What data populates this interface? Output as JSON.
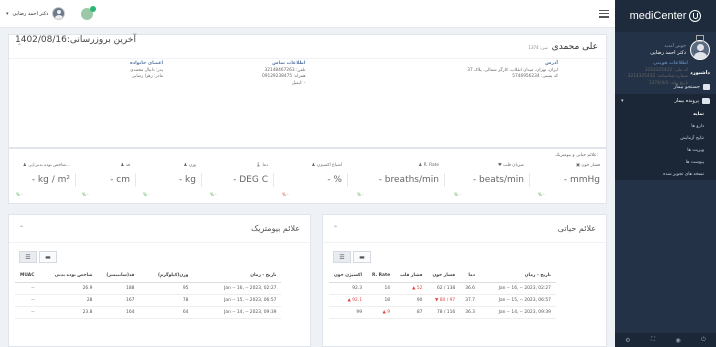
{
  "brand": {
    "name": "mediCenter"
  },
  "sidebar": {
    "greeting": "خوش آمدید",
    "user_name": "دکتر احمد رضایی",
    "items": [
      {
        "label": "داشبورد"
      },
      {
        "label": "جستجو بیمار"
      },
      {
        "label": "پرونده بیمار"
      }
    ],
    "subitems": [
      {
        "label": "نمایه"
      },
      {
        "label": "دارو ها"
      },
      {
        "label": "نتایج آزمایش"
      },
      {
        "label": "ویزیت ها"
      },
      {
        "label": "پیوست ها"
      },
      {
        "label": "نسخه های تجویز شده"
      }
    ]
  },
  "topbar": {
    "user_name": "دکتر احمد رضایی"
  },
  "patient": {
    "name": "علی محمدی",
    "age": "سن: 1374",
    "last_update": "آخرین بروزرسانی:1402/08/16",
    "dots": "...",
    "identity": {
      "title": "اطلاعات هویتی",
      "lines": [
        "کد ملی: 3214325432",
        "شماره شناسنامه: 3214325432",
        "تاریخ تولد: 1374/4/3"
      ]
    },
    "address": {
      "title": "آدرس",
      "lines": [
        "ایران، تهران، میدان انقلاب، کارگر شمالی، پلاک 37",
        "کد پستی: 5746956234"
      ]
    },
    "contact": {
      "title": "اطلاعات تماس",
      "lines": [
        "تلفن: 32148467263",
        "همراه: 09129238475",
        "ایمیل: -"
      ]
    },
    "family": {
      "title": "اعضای خانواده",
      "lines": [
        "پدر: دانیال محمدی",
        "مادر: زهرا رضایی"
      ]
    }
  },
  "vitals": {
    "title": "علائم حیاتی و بیومتریک:",
    "items": [
      {
        "label": "فشار خون",
        "value": "- mmHg",
        "trend": "% -"
      },
      {
        "label": "ضربان قلب",
        "value": "- beats/min",
        "trend": "% -"
      },
      {
        "label": "R. Rate",
        "value": "- breaths/min",
        "trend": "% -"
      },
      {
        "label": "اشباع اکسیژن",
        "value": "- %",
        "trend": "% -"
      },
      {
        "label": "دما",
        "value": "- DEG C",
        "trend": "% -"
      },
      {
        "label": "وزن",
        "value": "- kg",
        "trend": "% -"
      },
      {
        "label": "قد",
        "value": "- cm",
        "trend": "% -"
      },
      {
        "label": "شاخص توده بدنی(بی...",
        "value": "- kg / m²",
        "trend": "% -"
      }
    ]
  },
  "vital_signs_panel": {
    "title": "علائم حیاتی",
    "columns": [
      "تاریخ - زمان",
      "دما",
      "فشار خون",
      "فشار قلب",
      "R. Rate",
      "اکسیژن خون"
    ],
    "rows": [
      [
        "Jan -- 16, -- 2023, 02:27",
        "36.6",
        "62 / 138",
        "▲ 52",
        "14",
        "92.3"
      ],
      [
        "Jan -- 15, -- 2023, 06:57",
        "37.7",
        "▼ 80 / 97",
        "90",
        "18",
        "▲ 92.1"
      ],
      [
        "Jan -- 14, -- 2023, 09:39",
        "36.3",
        "78 / 116",
        "87",
        "▲ 9",
        "99"
      ]
    ]
  },
  "biometric_panel": {
    "title": "علائم بیومتریک",
    "columns": [
      "تاریخ - زمان",
      "وزن(کیلوگرم)",
      "قد(سانتیمتر)",
      "شاخص توده بدنی",
      "MUAC"
    ],
    "rows": [
      [
        "Jan -- 16, -- 2023, 02:27",
        "95",
        "188",
        "26.9",
        "--"
      ],
      [
        "Jan -- 15, -- 2023, 06:57",
        "78",
        "167",
        "28",
        "--"
      ],
      [
        "Jan -- 14, -- 2023, 09:39",
        "64",
        "164",
        "23.8",
        "--"
      ]
    ]
  },
  "colors": {
    "sidebar": "#233246",
    "accent": "#5a7ba6",
    "alert": "#e04848",
    "good": "#4caf50"
  }
}
